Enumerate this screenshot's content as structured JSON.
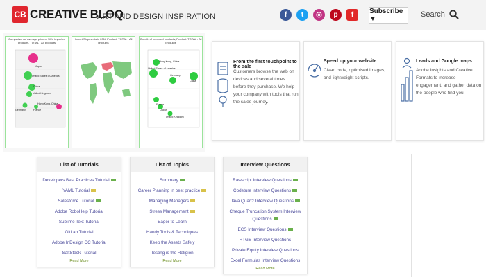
{
  "header": {
    "logo_mark": "CB",
    "logo_word": "CREATIVE BLOQ",
    "tagline": "ART AND DESIGN INSPIRATION",
    "social_icons": [
      "facebook-icon",
      "twitter-icon",
      "instagram-icon",
      "pinterest-icon",
      "flipboard-icon"
    ],
    "subscribe_label": "Subscribe ▼",
    "search_label": "Search"
  },
  "colors": {
    "brand_red": "#e0262e",
    "facebook": "#3b5998",
    "twitter": "#1da1f2",
    "instagram": "#c13584",
    "pinterest": "#bd081c",
    "flipboard": "#e12828",
    "bubble_pink": "#e6197f",
    "bubble_green": "#2ecc40"
  },
  "charts": {
    "left": {
      "title": "Comparison of average price of SKU imported products, TOTAL - All products",
      "labels": [
        "Japan",
        "United States of America",
        "China",
        "United Kingdom",
        "Hong Kong, China",
        "Germany",
        "France"
      ]
    },
    "middle": {
      "title": "Import Shipments in 2016 Product: TOTAL - All products"
    },
    "right": {
      "title": "Growth of imported products, Product: TOTAL - All products",
      "labels": [
        "Hong Kong, China",
        "United States of America",
        "China",
        "Germany",
        "France",
        "Japan",
        "United Kingdom"
      ]
    }
  },
  "cards": [
    {
      "title": "From the first touchpoint to the sale",
      "body": "Customers browse the web on devices and several times before they purchase. We help your company with tools that run the sales journey."
    },
    {
      "title": "Speed up your website",
      "body": "Clean code, optimised images, and lightweight scripts."
    },
    {
      "title": "Leads and Google maps",
      "body": "Adobe Insights and Creative Formats to increase engagement, and gather data on the people who find you."
    }
  ],
  "tutorials": {
    "title": "List of Tutorials",
    "items": [
      "Developers Best Practices Tutorial",
      "YAML Tutorial",
      "Salesforce Tutorial",
      "Adobe RoboHelp Tutorial",
      "Sublime Text Tutorial",
      "GitLab Tutorial",
      "Adobe InDesign CC Tutorial",
      "SaltStack Tutorial"
    ],
    "read_more": "Read More"
  },
  "topics": {
    "title": "List of Topics",
    "items": [
      "Summary",
      "Career Planning in best practice",
      "Managing Managers",
      "Stress Management",
      "Eager to Learn",
      "Handy Tools & Techniques",
      "Keep the Assets Safely",
      "Testing is the Religion"
    ],
    "read_more": "Read More"
  },
  "questions": {
    "title": "Interview Questions",
    "items": [
      "Rawscript Interview Questions",
      "Codeture Interview Questions",
      "Java Quartz Interview Questions",
      "Cheque Truncation System Interview Questions",
      "ECS Interview Questions",
      "RTGS Interview Questions",
      "Private Equity Interview Questions",
      "Excel Formulas Interview Questions"
    ],
    "read_more": "Read More"
  }
}
